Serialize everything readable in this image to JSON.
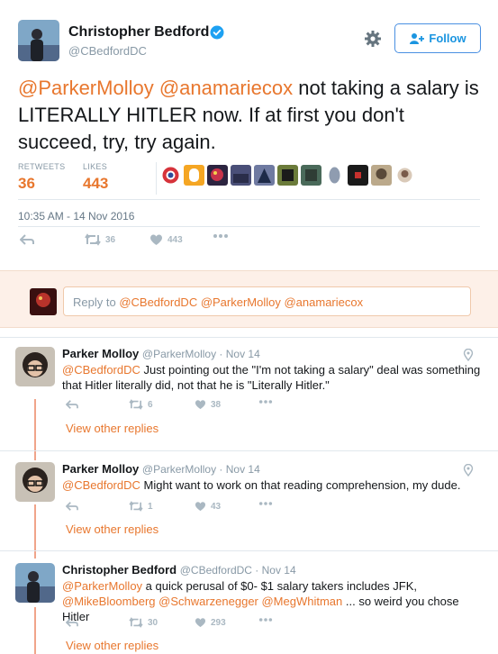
{
  "author": {
    "name": "Christopher Bedford",
    "handle": "@CBedfordDC"
  },
  "follow_label": "Follow",
  "tweet": {
    "mentions": [
      "@ParkerMolloy",
      "@anamariecox"
    ],
    "text": " not taking a salary is LITERALLY HITLER now. If at first you don't succeed, try, try again."
  },
  "stats": {
    "retweets_label": "RETWEETS",
    "retweets": "36",
    "likes_label": "LIKES",
    "likes": "443"
  },
  "timestamp": "10:35 AM - 14 Nov 2016",
  "actions": {
    "retweets": "36",
    "likes": "443"
  },
  "reply_box": {
    "prefix": "Reply to ",
    "mentions": "@CBedfordDC @ParkerMolloy @anamariecox"
  },
  "replies": [
    {
      "name": "Parker Molloy",
      "handle": "@ParkerMolloy",
      "date": " · Nov 14",
      "mention": "@CBedfordDC",
      "text": " Just pointing out the \"I'm not taking a salary\" deal was something that Hitler literally did, not that he is \"Literally Hitler.\"",
      "retweets": "6",
      "likes": "38",
      "more": "View other replies"
    },
    {
      "name": "Parker Molloy",
      "handle": "@ParkerMolloy",
      "date": " · Nov 14",
      "mention": "@CBedfordDC",
      "text": " Might want to work on that reading comprehension, my dude.",
      "retweets": "1",
      "likes": "43",
      "more": "View other replies"
    },
    {
      "name": "Christopher Bedford",
      "handle": "@CBedfordDC",
      "date": " · Nov 14",
      "mention": "@ParkerMolloy",
      "text1": " a quick perusal of $0- $1 salary takers includes JFK,",
      "mentions2": "@MikeBloomberg @Schwarzenegger @MegWhitman",
      "text2": " ... so weird you chose Hitler",
      "retweets": "30",
      "likes": "293",
      "more": "View other replies"
    }
  ],
  "colors": {
    "accent": "#e8772e",
    "follow_blue": "#1b95e0",
    "reply_bg": "#fdf0e8",
    "thread_line": "#f0a48a"
  },
  "icons": [
    "verified-badge-icon",
    "gear-icon",
    "follow-user-icon",
    "reply-icon",
    "retweet-icon",
    "like-icon",
    "more-icon",
    "location-pin-icon"
  ]
}
